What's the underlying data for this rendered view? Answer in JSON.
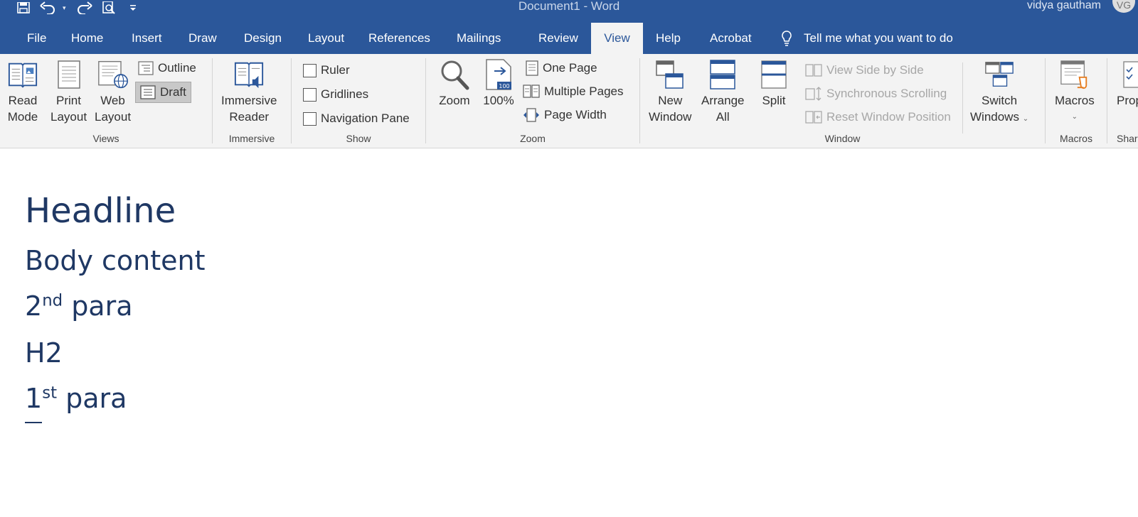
{
  "titlebar": {
    "document_title": "Document1  -  Word",
    "user_name": "vidya gautham",
    "user_initials": "VG",
    "qat_icons": [
      "save-icon",
      "undo-icon",
      "redo-icon",
      "print-preview-icon",
      "customize-qat-icon"
    ]
  },
  "tabs": [
    {
      "label": "File"
    },
    {
      "label": "Home"
    },
    {
      "label": "Insert"
    },
    {
      "label": "Draw"
    },
    {
      "label": "Design"
    },
    {
      "label": "Layout"
    },
    {
      "label": "References"
    },
    {
      "label": "Mailings"
    },
    {
      "label": "Review"
    },
    {
      "label": "View",
      "active": true
    },
    {
      "label": "Help"
    },
    {
      "label": "Acrobat"
    }
  ],
  "tell_me": "Tell me what you want to do",
  "ribbon": {
    "views": {
      "label": "Views",
      "read_mode": [
        "Read",
        "Mode"
      ],
      "print_layout": [
        "Print",
        "Layout"
      ],
      "web_layout": [
        "Web",
        "Layout"
      ],
      "outline": "Outline",
      "draft": "Draft"
    },
    "immersive": {
      "label": "Immersive",
      "reader": [
        "Immersive",
        "Reader"
      ]
    },
    "show": {
      "label": "Show",
      "ruler": "Ruler",
      "gridlines": "Gridlines",
      "navigation_pane": "Navigation Pane"
    },
    "zoom": {
      "label": "Zoom",
      "zoom": "Zoom",
      "hundred": "100%",
      "hundred_badge": "100",
      "one_page": "One Page",
      "multiple_pages": "Multiple Pages",
      "page_width": "Page Width"
    },
    "window": {
      "label": "Window",
      "new_window": [
        "New",
        "Window"
      ],
      "arrange_all": [
        "Arrange",
        "All"
      ],
      "split": "Split",
      "view_side_by_side": "View Side by Side",
      "synchronous_scrolling": "Synchronous Scrolling",
      "reset_window_position": "Reset Window Position",
      "switch_windows": [
        "Switch",
        "Windows"
      ]
    },
    "macros": {
      "label": "Macros",
      "macros": "Macros"
    },
    "partial": {
      "properties": "Prop",
      "share": "Shar"
    }
  },
  "colors": {
    "brand_blue": "#2b579a",
    "ribbon_bg": "#f3f3f3",
    "doc_text": "#1f3864"
  },
  "document": {
    "headline": "Headline",
    "body": "Body content",
    "para2_num": "2",
    "para2_sup": "nd",
    "para2_text": " para",
    "h2": "H2",
    "para1_num": "1",
    "para1_sup": "st",
    "para1_text": " para"
  }
}
